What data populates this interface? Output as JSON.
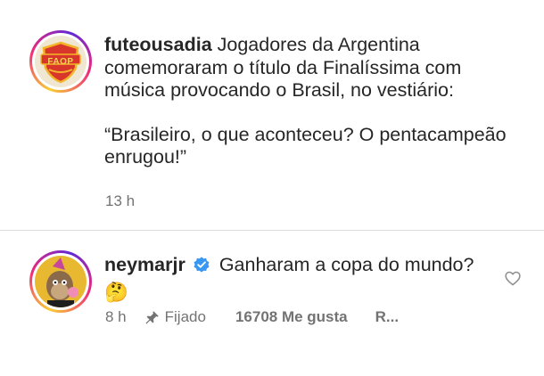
{
  "post": {
    "username": "futeousadia",
    "caption_line1": "Jogadores da Argentina comemoraram o título da Finalíssima com música provocando o Brasil, no vestiário:",
    "caption_quote": "“Brasileiro, o que aconteceu? O pentacampeão enrugou!”",
    "time": "13 h",
    "avatar_logo_text": "FAOP"
  },
  "comment": {
    "username": "neymarjr",
    "text": "Ganharam a copa do mundo?",
    "emoji": "🤔",
    "time": "8 h",
    "pinned_label": "Fijado",
    "likes": "16708 Me gusta",
    "reply": "R..."
  },
  "icons": {
    "verified": "verified-badge-icon",
    "pin": "pin-icon",
    "like": "heart-icon"
  },
  "colors": {
    "verified_blue": "#3897f0",
    "meta_gray": "#737373",
    "text": "#262626"
  }
}
